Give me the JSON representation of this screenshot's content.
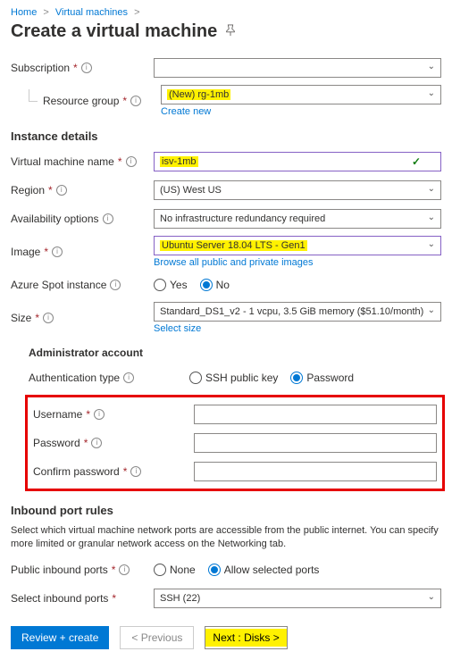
{
  "breadcrumb": {
    "home": "Home",
    "vms": "Virtual machines"
  },
  "page_title": "Create a virtual machine",
  "labels": {
    "subscription": "Subscription",
    "resource_group": "Resource group",
    "instance_details": "Instance details",
    "vm_name": "Virtual machine name",
    "region": "Region",
    "availability": "Availability options",
    "image": "Image",
    "spot": "Azure Spot instance",
    "size": "Size",
    "admin_account": "Administrator account",
    "auth_type": "Authentication type",
    "username": "Username",
    "password": "Password",
    "confirm_password": "Confirm password",
    "inbound_rules": "Inbound port rules",
    "inbound_desc": "Select which virtual machine network ports are accessible from the public internet. You can specify more limited or granular network access on the Networking tab.",
    "public_ports": "Public inbound ports",
    "select_ports": "Select inbound ports"
  },
  "values": {
    "subscription": "",
    "resource_group": "(New) rg-1mb",
    "create_new": "Create new",
    "vm_name": "isv-1mb",
    "region": "(US) West US",
    "availability": "No infrastructure redundancy required",
    "image": "Ubuntu Server 18.04 LTS - Gen1",
    "browse_images": "Browse all public and private images",
    "size": "Standard_DS1_v2 - 1 vcpu, 3.5 GiB memory ($51.10/month)",
    "select_size": "Select size",
    "select_ports": "SSH (22)"
  },
  "radios": {
    "yes": "Yes",
    "no": "No",
    "ssh": "SSH public key",
    "password": "Password",
    "none": "None",
    "allow": "Allow selected ports"
  },
  "footer": {
    "review": "Review + create",
    "previous": "< Previous",
    "next": "Next : Disks >"
  }
}
